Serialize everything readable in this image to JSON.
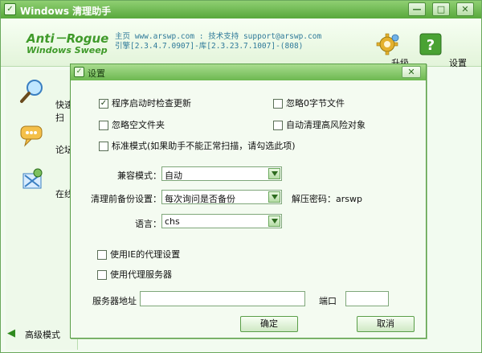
{
  "window": {
    "title": "Windows 清理助手",
    "buttons": [
      "—",
      "□",
      "✕"
    ]
  },
  "header": {
    "logo_line1": "Anti－Rogue",
    "logo_line2": "Windows Sweep",
    "info_line1": "主页 www.arswp.com : 技术支持 support@arswp.com",
    "info_line2": "引擎[2.3.4.7.0907]-库[2.3.23.7.1007]-(808)",
    "tools": [
      {
        "icon": "gear-icon",
        "label": "升级"
      },
      {
        "icon": "help-icon",
        "label": "设置"
      }
    ]
  },
  "sidebar": {
    "items": [
      {
        "icon": "magnifier-icon",
        "label": "快速扫"
      },
      {
        "icon": "chat-bubble-icon",
        "label": "论坛"
      },
      {
        "icon": "online-icon",
        "label": "在线"
      }
    ],
    "advanced_mode_label": "高级模式"
  },
  "dialog": {
    "title": "设置",
    "close_label": "✕",
    "options": [
      {
        "label": "程序启动时检查更新",
        "checked": true
      },
      {
        "label": "忽略0字节文件",
        "checked": false
      },
      {
        "label": "忽略空文件夹",
        "checked": false
      },
      {
        "label": "自动清理高风险对象",
        "checked": false
      },
      {
        "label": "标准模式(如果助手不能正常扫描，请勾选此项)",
        "checked": false
      }
    ],
    "compat_mode": {
      "label": "兼容模式：",
      "value": "自动"
    },
    "backup": {
      "label": "清理前备份设置：",
      "value": "每次询问是否备份"
    },
    "unzip_password": "解压密码：arswp",
    "language": {
      "label": "语言：",
      "value": "chs"
    },
    "proxy_options": [
      {
        "label": "使用IE的代理设置",
        "checked": false
      },
      {
        "label": "使用代理服务器",
        "checked": false
      }
    ],
    "server_label": "服务器地址",
    "server_value": "",
    "port_label": "端口",
    "port_value": "",
    "ok_label": "确定",
    "cancel_label": "取消"
  }
}
